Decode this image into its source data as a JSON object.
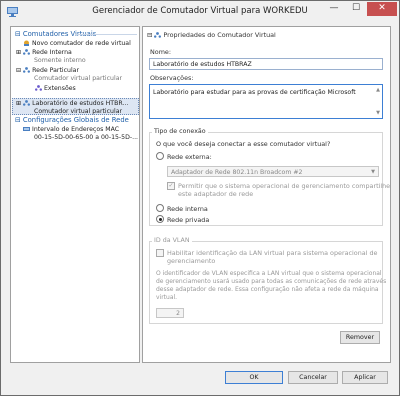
{
  "window": {
    "title": "Gerenciador de Comutador Virtual para WORKEDU",
    "minimize": "—",
    "maximize": "☐",
    "close": "✕"
  },
  "tree": {
    "category_switches": "Comutadores Virtuais",
    "new_switch": "Novo comutador de rede virtual",
    "internal_network": "Rede Interna",
    "internal_network_sub": "Somente interno",
    "private_network": "Rede Particular",
    "private_network_sub": "Comutador virtual particular",
    "extensions": "Extensões",
    "selected_item": "Laboratório de estudos HTBR...",
    "selected_item_sub": "Comutador virtual particular",
    "category_global": "Configurações Globais de Rede",
    "mac_range": "Intervalo de Endereços MAC",
    "mac_range_sub": "00-15-5D-00-65-00 a 00-15-5D-..."
  },
  "properties": {
    "section_title": "Propriedades do Comutador Virtual",
    "name_label": "Nome:",
    "name_value": "Laboratório de estudos HTBRAZ",
    "notes_label": "Observações:",
    "notes_value": "Laboratório para estudar para as provas de certificação Microsoft",
    "connection_type_title": "Tipo de conexão",
    "connection_question": "O que você deseja conectar a esse comutador virtual?",
    "external_network": "Rede externa:",
    "adapter_value": "Adaptador de Rede 802.11n Broadcom #2",
    "allow_os_line1": "Permitir que o sistema operacional de gerenciamento compartilhe",
    "allow_os_line2": "este adaptador de rede",
    "internal_radio": "Rede interna",
    "private_radio": "Rede privada",
    "selected_connection": "Rede privada",
    "vlan_title": "ID da VLAN",
    "vlan_check_line1": "Habilitar identificação da LAN virtual para sistema operacional de",
    "vlan_check_line2": "gerenciamento",
    "vlan_desc_1": "O identificador de VLAN especifica a LAN virtual que o sistema operacional",
    "vlan_desc_2": "de gerenciamento usará usado para todas as comunicações de rede através",
    "vlan_desc_3": "desse adaptador de rede. Essa configuração não afeta a rede da máquina",
    "vlan_desc_4": "virtual.",
    "vlan_value": "2",
    "remove_button": "Remover"
  },
  "footer": {
    "ok": "OK",
    "cancel": "Cancelar",
    "apply": "Aplicar"
  },
  "colors": {
    "accent": "#3d7fd4",
    "category": "#1f5fa8",
    "close_button": "#c75050"
  }
}
